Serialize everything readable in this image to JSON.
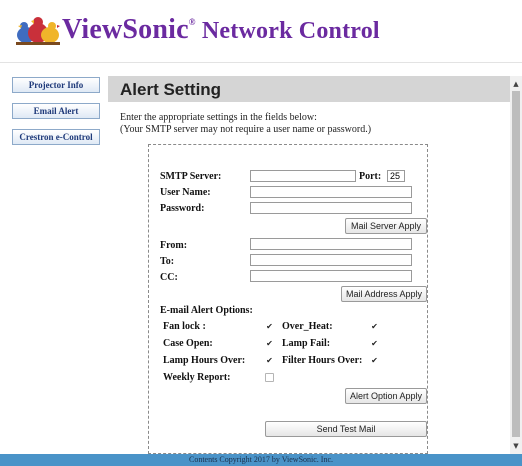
{
  "header": {
    "brand_main": "ViewSonic",
    "brand_reg": "®",
    "brand_tail": " Network Control"
  },
  "sidebar": {
    "items": [
      {
        "label": "Projector Info"
      },
      {
        "label": "Email Alert"
      },
      {
        "label": "Crestron e-Control"
      }
    ]
  },
  "main": {
    "title": "Alert Setting",
    "intro_line1": "Enter the appropriate settings in the fields below:",
    "intro_line2": "(Your SMTP server may not require a user name or password.)"
  },
  "server": {
    "smtp_label": "SMTP Server:",
    "smtp_value": "",
    "port_label": "Port:",
    "port_value": "25",
    "user_label": "User Name:",
    "user_value": "",
    "password_label": "Password:",
    "password_value": "",
    "apply_label": "Mail Server Apply"
  },
  "address": {
    "from_label": "From:",
    "from_value": "",
    "to_label": "To:",
    "to_value": "",
    "cc_label": "CC:",
    "cc_value": "",
    "apply_label": "Mail Address Apply"
  },
  "options": {
    "heading": "E-mail Alert Options:",
    "fan_lock": {
      "label": "Fan lock :",
      "checked": true
    },
    "over_heat": {
      "label": "Over_Heat:",
      "checked": true
    },
    "case_open": {
      "label": "Case Open:",
      "checked": true
    },
    "lamp_fail": {
      "label": "Lamp Fail:",
      "checked": true
    },
    "lamp_hours": {
      "label": "Lamp Hours Over:",
      "checked": true
    },
    "filter_hours": {
      "label": "Filter Hours Over:",
      "checked": true
    },
    "weekly_report": {
      "label": "Weekly Report:",
      "checked": false
    },
    "apply_label": "Alert Option Apply",
    "test_label": "Send Test Mail"
  },
  "footer": {
    "text": "Contents Copyright 2017 by ViewSonic. Inc."
  },
  "colors": {
    "brand": "#6b2aa0",
    "nav_text": "#1f3a7a",
    "footer_bg": "#4a93c8",
    "title_bar": "#d5d5d5"
  },
  "icons": {
    "logo": "viewsonic-birds-icon",
    "checkbox_checked": "check-icon",
    "scroll_up": "arrow-up-icon",
    "scroll_down": "arrow-down-icon"
  }
}
